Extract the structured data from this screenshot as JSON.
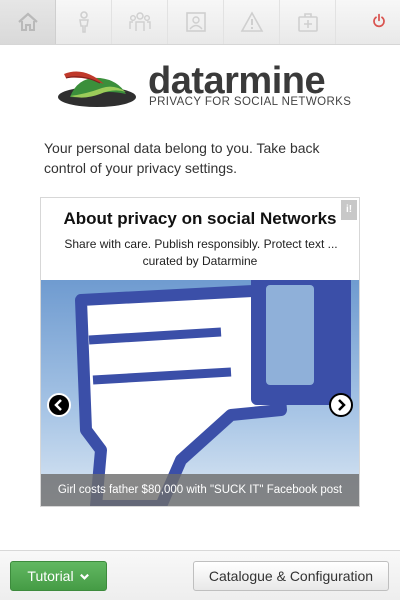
{
  "toolbar": {
    "tabs": [
      {
        "icon": "home-icon",
        "active": true
      },
      {
        "icon": "person-icon",
        "active": false
      },
      {
        "icon": "group-icon",
        "active": false
      },
      {
        "icon": "profile-picture-icon",
        "active": false
      },
      {
        "icon": "warning-icon",
        "active": false
      },
      {
        "icon": "medical-kit-icon",
        "active": false
      }
    ],
    "power_icon": "power-icon"
  },
  "logo": {
    "brand": "datarmine",
    "tagline": "PRIVACY FOR SOCIAL NETWORKS"
  },
  "intro": "Your personal data belong to you. Take back control of your privacy settings.",
  "card": {
    "title": "About privacy on social Networks",
    "subtitle": "Share with care. Publish responsibly. Protect text ...",
    "curated": "curated by Datarmine",
    "badge": "i!",
    "slide_caption": "Girl costs father $80,000 with \"SUCK IT\" Facebook post"
  },
  "footer": {
    "tutorial_label": "Tutorial",
    "catalogue_label": "Catalogue & Configuration"
  },
  "colors": {
    "accent_green": "#4cae4c",
    "power_red": "#d9534f",
    "thumb_blue": "#3b4fa8"
  }
}
